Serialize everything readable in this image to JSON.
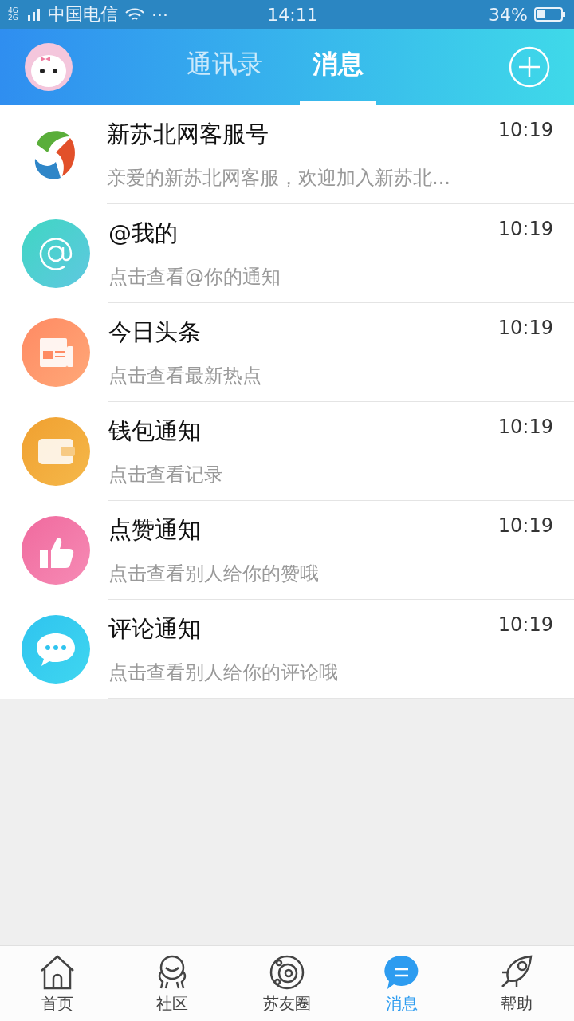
{
  "status_bar": {
    "network": "4G 2G",
    "carrier": "中国电信",
    "more": "···",
    "time": "14:11",
    "battery": "34%"
  },
  "header": {
    "tabs": [
      {
        "label": "通讯录",
        "selected": false
      },
      {
        "label": "消息",
        "selected": true
      }
    ]
  },
  "messages": [
    {
      "kind": "logo",
      "title": "新苏北网客服号",
      "time": "10:19",
      "preview": "亲爱的新苏北网客服，欢迎加入新苏北..."
    },
    {
      "kind": "at",
      "title": "@我的",
      "time": "10:19",
      "preview": "点击查看@你的通知"
    },
    {
      "kind": "news",
      "title": "今日头条",
      "time": "10:19",
      "preview": "点击查看最新热点"
    },
    {
      "kind": "wallet",
      "title": "钱包通知",
      "time": "10:19",
      "preview": "点击查看记录"
    },
    {
      "kind": "like",
      "title": "点赞通知",
      "time": "10:19",
      "preview": "点击查看别人给你的赞哦"
    },
    {
      "kind": "comment",
      "title": "评论通知",
      "time": "10:19",
      "preview": "点击查看别人给你的评论哦"
    }
  ],
  "bottom_nav": [
    {
      "kind": "home",
      "label": "首页",
      "selected": false
    },
    {
      "kind": "community",
      "label": "社区",
      "selected": false
    },
    {
      "kind": "circle",
      "label": "苏友圈",
      "selected": false
    },
    {
      "kind": "message",
      "label": "消息",
      "selected": true
    },
    {
      "kind": "help",
      "label": "帮助",
      "selected": false
    }
  ]
}
